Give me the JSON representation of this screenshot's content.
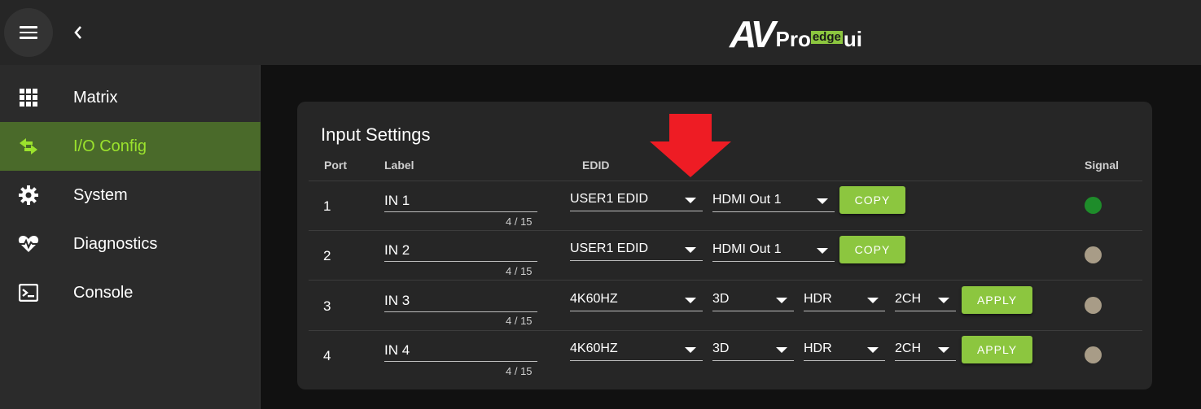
{
  "header": {
    "logo_av": "AV",
    "logo_pro": "Pro",
    "logo_edge": "edge",
    "logo_ui": "ui"
  },
  "sidebar": {
    "items": [
      {
        "label": "Matrix",
        "icon": "grid-icon",
        "active": false
      },
      {
        "label": "I/O Config",
        "icon": "swap-arrows-icon",
        "active": true
      },
      {
        "label": "System",
        "icon": "gear-icon",
        "active": false
      },
      {
        "label": "Diagnostics",
        "icon": "heart-pulse-icon",
        "active": false
      },
      {
        "label": "Console",
        "icon": "terminal-icon",
        "active": false
      }
    ]
  },
  "card": {
    "title": "Input Settings",
    "columns": {
      "port": "Port",
      "label": "Label",
      "edid": "EDID",
      "signal": "Signal"
    },
    "rows": [
      {
        "port": "1",
        "label": "IN 1",
        "counter": "4 / 15",
        "edid": "USER1 EDID",
        "source": "HDMI Out 1",
        "button": "COPY",
        "signal_color": "#1e8c2a"
      },
      {
        "port": "2",
        "label": "IN 2",
        "counter": "4 / 15",
        "edid": "USER1 EDID",
        "source": "HDMI Out 1",
        "button": "COPY",
        "signal_color": "#a89c87"
      },
      {
        "port": "3",
        "label": "IN 3",
        "counter": "4 / 15",
        "edid": "4K60HZ",
        "mode3d": "3D",
        "hdr": "HDR",
        "audio": "2CH",
        "button": "APPLY",
        "signal_color": "#a89c87"
      },
      {
        "port": "4",
        "label": "IN 4",
        "counter": "4 / 15",
        "edid": "4K60HZ",
        "mode3d": "3D",
        "hdr": "HDR",
        "audio": "2CH",
        "button": "APPLY",
        "signal_color": "#a89c87"
      }
    ]
  },
  "colors": {
    "accent": "#8cc63f",
    "active_nav_bg": "#4a6a2a",
    "active_nav_text": "#9be22d",
    "annotation_arrow": "#ee1c24"
  }
}
